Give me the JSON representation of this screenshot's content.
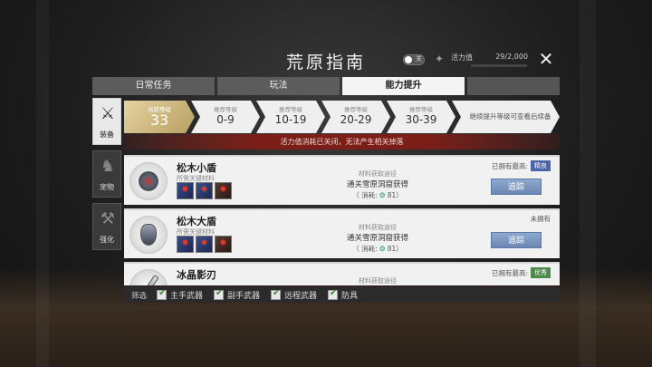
{
  "title": "荒原指南",
  "toggle": {
    "label": "关"
  },
  "energy": {
    "label": "活力值",
    "value": "29/2,000",
    "fraction": 0.0145
  },
  "tabs": [
    {
      "label": "日常任务",
      "active": false
    },
    {
      "label": "玩法",
      "active": false
    },
    {
      "label": "能力提升",
      "active": true
    }
  ],
  "side_tabs": [
    {
      "label": "装备",
      "icon": "sword-icon",
      "active": true
    },
    {
      "label": "宠物",
      "icon": "wolf-icon",
      "active": false
    },
    {
      "label": "强化",
      "icon": "anvil-icon",
      "active": false
    }
  ],
  "levels": {
    "current": {
      "small": "当前等级",
      "value": "33"
    },
    "recommended": [
      {
        "small": "推荐等级",
        "range": "0-9"
      },
      {
        "small": "推荐等级",
        "range": "10-19"
      },
      {
        "small": "推荐等级",
        "range": "20-29"
      },
      {
        "small": "推荐等级",
        "range": "30-39"
      }
    ],
    "more": "继续提升等级可查看后续备"
  },
  "notice": "活力值消耗已关闭，无法产生相关掉落",
  "items": [
    {
      "name": "松木小盾",
      "mat_label": "所需关键材料",
      "src_label": "材料获取途径",
      "source": "通关雪原洞窟获得",
      "cost_prefix": "（ 消耗:",
      "cost_value": "81）",
      "owned": "已拥有最高:",
      "badge": "精良",
      "track": "追踪"
    },
    {
      "name": "松木大盾",
      "mat_label": "所需关键材料",
      "src_label": "材料获取途径",
      "source": "通关雪原洞窟获得",
      "cost_prefix": "（ 消耗:",
      "cost_value": "81）",
      "owned": "未拥有",
      "track": "追踪"
    },
    {
      "name": "冰晶影刃",
      "src_label": "材料获取途径",
      "owned": "已拥有最高:",
      "badge": "优秀"
    }
  ],
  "filter": {
    "label": "筛选",
    "options": [
      {
        "label": "主手武器",
        "checked": true
      },
      {
        "label": "副手武器",
        "checked": true
      },
      {
        "label": "远程武器",
        "checked": true
      },
      {
        "label": "防具",
        "checked": true
      }
    ]
  },
  "colors": {
    "accent_gold": "#c9b27a",
    "notice_red": "#7b1e17",
    "track_blue": "#6a87b3",
    "badge_blue": "#4a64a8",
    "badge_green": "#4c8a4a"
  }
}
